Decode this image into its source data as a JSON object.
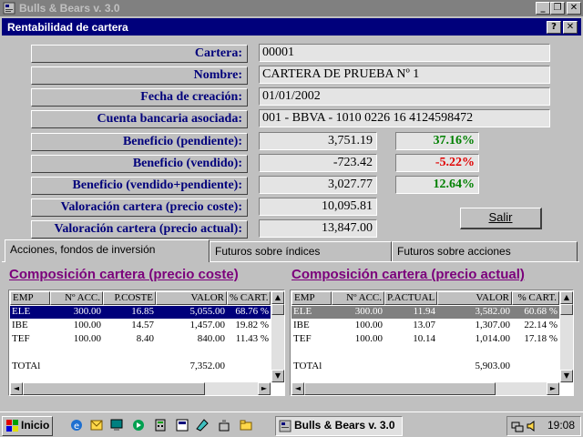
{
  "window": {
    "app_title": "Bulls & Bears v. 3.0",
    "inner_title": "Rentabilidad de cartera",
    "btn_minimize": "_",
    "btn_restore": "❐",
    "btn_close": "✕",
    "btn_help": "?"
  },
  "info": {
    "cartera_label": "Cartera:",
    "cartera_value": "00001",
    "nombre_label": "Nombre:",
    "nombre_value": "CARTERA DE PRUEBA Nº 1",
    "fecha_label": "Fecha de creación:",
    "fecha_value": "01/01/2002",
    "cuenta_label": "Cuenta bancaria asociada:",
    "cuenta_value": "001 - BBVA - 1010 0226 16 4124598472",
    "ben_pend_label": "Beneficio (pendiente):",
    "ben_pend_value": "3,751.19",
    "ben_pend_pct": "37.16%",
    "ben_vend_label": "Beneficio (vendido):",
    "ben_vend_value": "-723.42",
    "ben_vend_pct": "-5.22%",
    "ben_tot_label": "Beneficio (vendido+pendiente):",
    "ben_tot_value": "3,027.77",
    "ben_tot_pct": "12.64%",
    "val_coste_label": "Valoración cartera (precio coste):",
    "val_coste_value": "10,095.81",
    "val_actual_label": "Valoración cartera (precio actual):",
    "val_actual_value": "13,847.00"
  },
  "colors": {
    "positive": "#008000",
    "negative": "#e00000",
    "title_accent": "#7b007b",
    "label_blue": "#00007b"
  },
  "salir_label": "Salir",
  "tabs": [
    {
      "label": "Acciones, fondos de inversión"
    },
    {
      "label": "Futuros sobre índices"
    },
    {
      "label": "Futuros sobre acciones"
    }
  ],
  "coste": {
    "title": "Composición cartera (precio coste)",
    "headers": [
      "EMP",
      "Nº ACC.",
      "P.COSTE",
      "VALOR",
      "% CART."
    ],
    "rows": [
      [
        "ELE",
        "300.00",
        "16.85",
        "5,055.00",
        "68.76 %"
      ],
      [
        "IBE",
        "100.00",
        "14.57",
        "1,457.00",
        "19.82 %"
      ],
      [
        "TEF",
        "100.00",
        "8.40",
        "840.00",
        "11.43 %"
      ]
    ],
    "total_label": "TOTAl",
    "total_value": "7,352.00"
  },
  "actual": {
    "title": "Composición cartera (precio actual)",
    "headers": [
      "EMP",
      "Nº ACC.",
      "P.ACTUAL",
      "VALOR",
      "% CART."
    ],
    "rows": [
      [
        "ELE",
        "300.00",
        "11.94",
        "3,582.00",
        "60.68 %"
      ],
      [
        "IBE",
        "100.00",
        "13.07",
        "1,307.00",
        "22.14 %"
      ],
      [
        "TEF",
        "100.00",
        "10.14",
        "1,014.00",
        "17.18 %"
      ]
    ],
    "total_label": "TOTAl",
    "total_value": "5,903.00"
  },
  "scroll": {
    "up": "▲",
    "down": "▼",
    "left": "◄",
    "right": "►"
  },
  "taskbar": {
    "start_label": "Inicio",
    "task_label": "Bulls & Bears v. 3.0",
    "clock": "19:08",
    "quicklaunch_icons": [
      "ie-icon",
      "outlook-icon",
      "desktop-icon",
      "media-icon",
      "calc-icon",
      "app-icon",
      "paint-icon",
      "tool-icon",
      "folder-icon"
    ]
  }
}
